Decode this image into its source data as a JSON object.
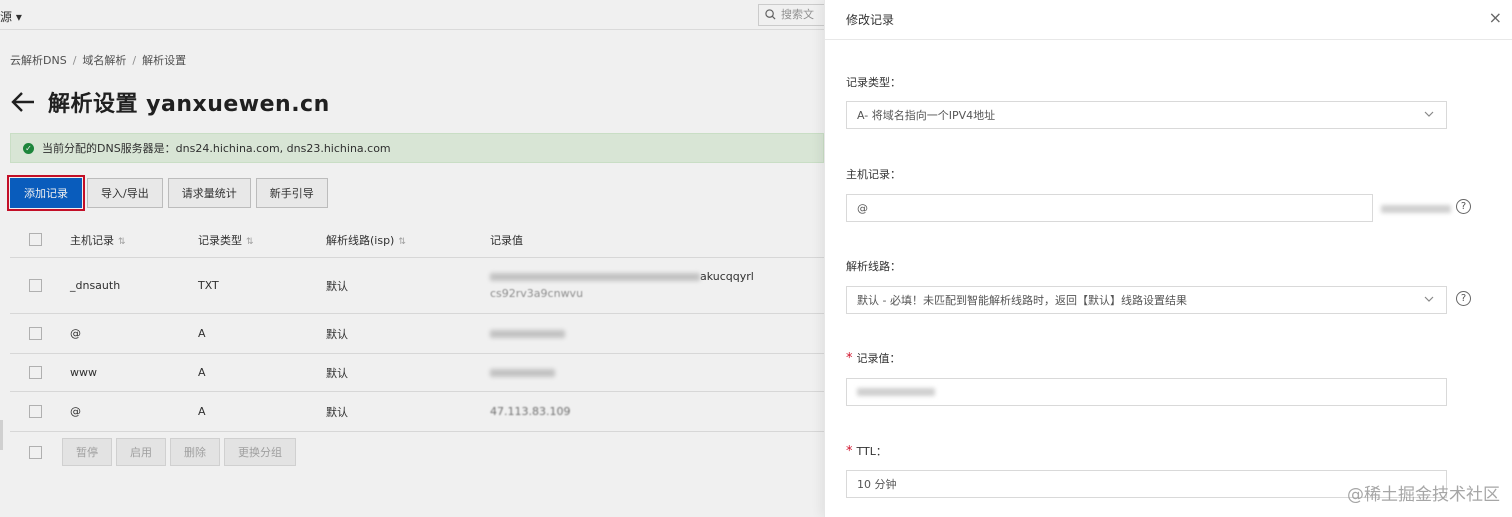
{
  "topbar": {
    "resource_label": "源 ▾",
    "search_placeholder": "搜索文"
  },
  "breadcrumb": [
    "云解析DNS",
    "域名解析",
    "解析设置"
  ],
  "page_title": "解析设置 yanxuewen.cn",
  "dns_notice": "当前分配的DNS服务器是：dns24.hichina.com, dns23.hichina.com",
  "toolbar": {
    "add_record": "添加记录",
    "import_export": "导入/导出",
    "request_stats": "请求量统计",
    "beginner_guide": "新手引导"
  },
  "table": {
    "headers": [
      "主机记录",
      "记录类型",
      "解析线路(isp)",
      "记录值"
    ],
    "rows": [
      {
        "host": "_dnsauth",
        "type": "TXT",
        "line": "默认",
        "value_tail": "akucqqyrl",
        "value_line2": "cs92rv3a9cnwvu"
      },
      {
        "host": "@",
        "type": "A",
        "line": "默认",
        "value_tail": "",
        "value_line2": ""
      },
      {
        "host": "www",
        "type": "A",
        "line": "默认",
        "value_tail": "",
        "value_line2": ""
      },
      {
        "host": "@",
        "type": "A",
        "line": "默认",
        "value_tail": "47.113.83.109",
        "value_line2": ""
      }
    ]
  },
  "bottom_actions": [
    "暂停",
    "启用",
    "删除",
    "更换分组"
  ],
  "drawer": {
    "title": "修改记录",
    "close": "×",
    "record_type_label": "记录类型：",
    "record_type_value": "A- 将域名指向一个IPV4地址",
    "host_label": "主机记录：",
    "host_value": "@",
    "line_label": "解析线路：",
    "line_value": "默认 - 必填！未匹配到智能解析线路时，返回【默认】线路设置结果",
    "value_label": "记录值：",
    "ttl_label": "TTL：",
    "ttl_value": "10 分钟",
    "help": "?"
  },
  "watermark": "@稀土掘金技术社区"
}
